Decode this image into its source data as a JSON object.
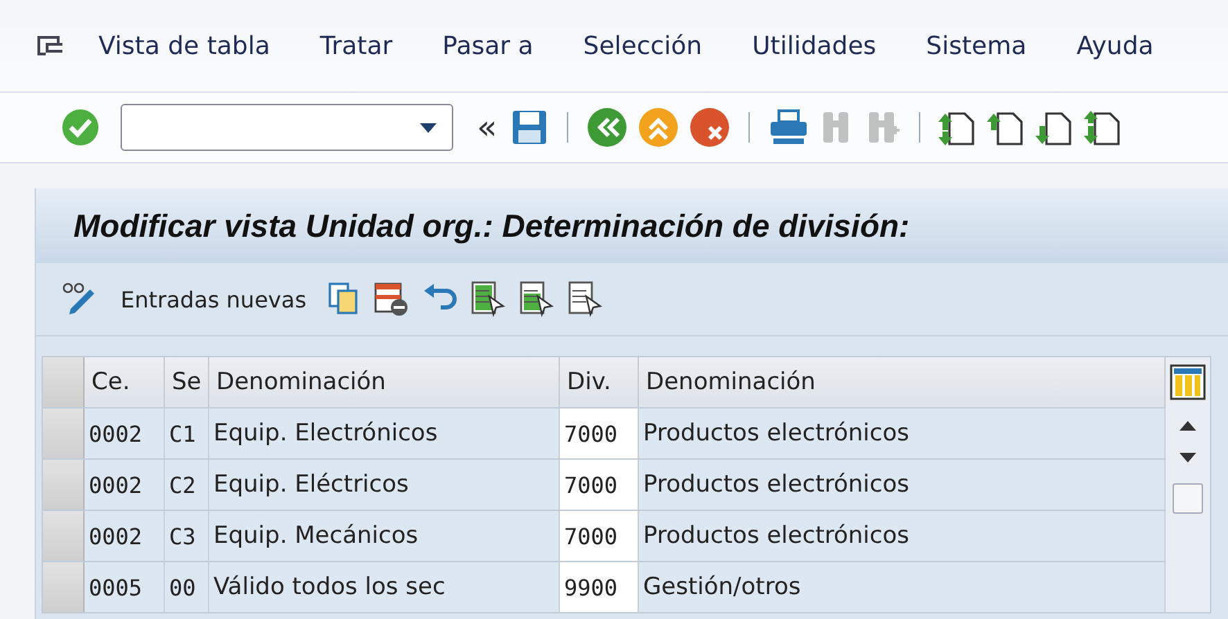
{
  "menu": [
    "Vista de tabla",
    "Tratar",
    "Pasar a",
    "Selección",
    "Utilidades",
    "Sistema",
    "Ayuda"
  ],
  "toolbar": [
    {
      "kind": "enter",
      "disabled": false
    },
    {
      "kind": "command-field"
    },
    {
      "kind": "collapse",
      "text": "«",
      "disabled": false
    },
    {
      "kind": "save",
      "disabled": false
    },
    {
      "kind": "sep"
    },
    {
      "kind": "back",
      "disabled": false
    },
    {
      "kind": "exit",
      "disabled": false
    },
    {
      "kind": "cancel",
      "disabled": false
    },
    {
      "kind": "sep"
    },
    {
      "kind": "print",
      "disabled": false
    },
    {
      "kind": "find",
      "disabled": true
    },
    {
      "kind": "find-next",
      "disabled": true
    },
    {
      "kind": "sep"
    },
    {
      "kind": "first-page",
      "disabled": false
    },
    {
      "kind": "prev-page",
      "disabled": false
    },
    {
      "kind": "next-page",
      "disabled": false
    },
    {
      "kind": "last-page",
      "disabled": false
    }
  ],
  "title": "Modificar vista Unidad org.: Determinación de división:",
  "app_toolbar": [
    {
      "kind": "edit-toggle"
    },
    {
      "kind": "label",
      "text": "Entradas nuevas"
    },
    {
      "kind": "copy"
    },
    {
      "kind": "delete"
    },
    {
      "kind": "undo"
    },
    {
      "kind": "select-all"
    },
    {
      "kind": "select-block"
    },
    {
      "kind": "deselect-all"
    }
  ],
  "table": {
    "columns": [
      "Ce.",
      "Se",
      "Denominación",
      "Div.",
      "Denominación"
    ],
    "rows": [
      {
        "cells": [
          "0002",
          "C1",
          "Equip. Electrónicos",
          "7000",
          "Productos electrónicos"
        ],
        "selected": false
      },
      {
        "cells": [
          "0002",
          "C2",
          "Equip. Eléctricos",
          "7000",
          "Productos electrónicos"
        ],
        "selected": false
      },
      {
        "cells": [
          "0002",
          "C3",
          "Equip. Mecánicos",
          "7000",
          "Productos electrónicos"
        ],
        "selected": false
      },
      {
        "cells": [
          "0005",
          "00",
          "Válido todos los sec",
          "9900",
          "Gestión/otros"
        ],
        "selected": false
      }
    ]
  }
}
